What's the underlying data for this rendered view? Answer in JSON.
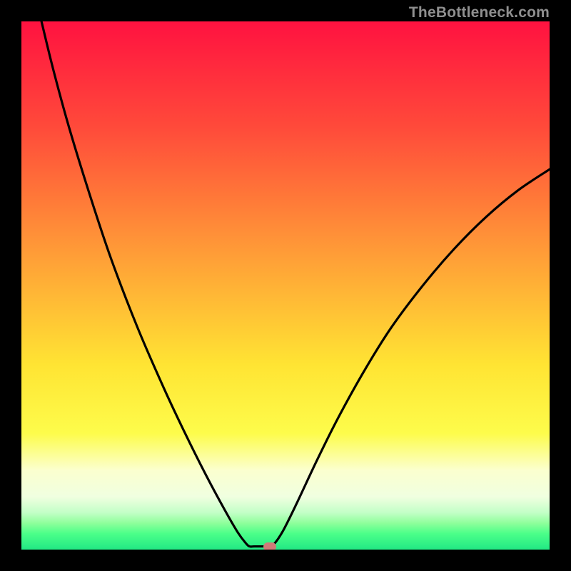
{
  "watermark": "TheBottleneck.com",
  "chart_data": {
    "type": "line",
    "title": "",
    "xlabel": "",
    "ylabel": "",
    "xlim": [
      0,
      100
    ],
    "ylim": [
      0,
      100
    ],
    "grid": false,
    "background": {
      "type": "vertical-gradient",
      "stops": [
        {
          "pos": 0.0,
          "color": "#ff1240"
        },
        {
          "pos": 0.2,
          "color": "#ff4a3a"
        },
        {
          "pos": 0.45,
          "color": "#ffa037"
        },
        {
          "pos": 0.65,
          "color": "#ffe433"
        },
        {
          "pos": 0.78,
          "color": "#fdfc4b"
        },
        {
          "pos": 0.85,
          "color": "#fbffcf"
        },
        {
          "pos": 0.9,
          "color": "#f0ffe0"
        },
        {
          "pos": 0.93,
          "color": "#c3ffc7"
        },
        {
          "pos": 0.95,
          "color": "#8eff9b"
        },
        {
          "pos": 0.97,
          "color": "#4bff89"
        },
        {
          "pos": 1.0,
          "color": "#22e884"
        }
      ]
    },
    "series": [
      {
        "name": "bottleneck-curve",
        "color": "#000000",
        "points": [
          {
            "x": 3.8,
            "y": 100.0
          },
          {
            "x": 6.0,
            "y": 91.0
          },
          {
            "x": 9.0,
            "y": 80.0
          },
          {
            "x": 13.0,
            "y": 67.0
          },
          {
            "x": 17.0,
            "y": 55.0
          },
          {
            "x": 22.0,
            "y": 42.0
          },
          {
            "x": 27.0,
            "y": 30.5
          },
          {
            "x": 31.0,
            "y": 22.0
          },
          {
            "x": 35.0,
            "y": 14.0
          },
          {
            "x": 38.5,
            "y": 7.5
          },
          {
            "x": 41.0,
            "y": 3.2
          },
          {
            "x": 42.5,
            "y": 1.2
          },
          {
            "x": 43.2,
            "y": 0.6
          },
          {
            "x": 44.0,
            "y": 0.6
          },
          {
            "x": 46.0,
            "y": 0.6
          },
          {
            "x": 47.0,
            "y": 0.6
          },
          {
            "x": 47.8,
            "y": 1.0
          },
          {
            "x": 49.5,
            "y": 3.5
          },
          {
            "x": 52.0,
            "y": 8.5
          },
          {
            "x": 56.0,
            "y": 17.0
          },
          {
            "x": 60.0,
            "y": 25.0
          },
          {
            "x": 65.0,
            "y": 34.0
          },
          {
            "x": 70.0,
            "y": 42.0
          },
          {
            "x": 76.0,
            "y": 50.0
          },
          {
            "x": 82.0,
            "y": 57.0
          },
          {
            "x": 88.0,
            "y": 63.0
          },
          {
            "x": 94.0,
            "y": 68.0
          },
          {
            "x": 100.0,
            "y": 72.0
          }
        ]
      }
    ],
    "marker": {
      "x": 47.0,
      "y": 0.6,
      "color": "#cf7a78"
    }
  }
}
